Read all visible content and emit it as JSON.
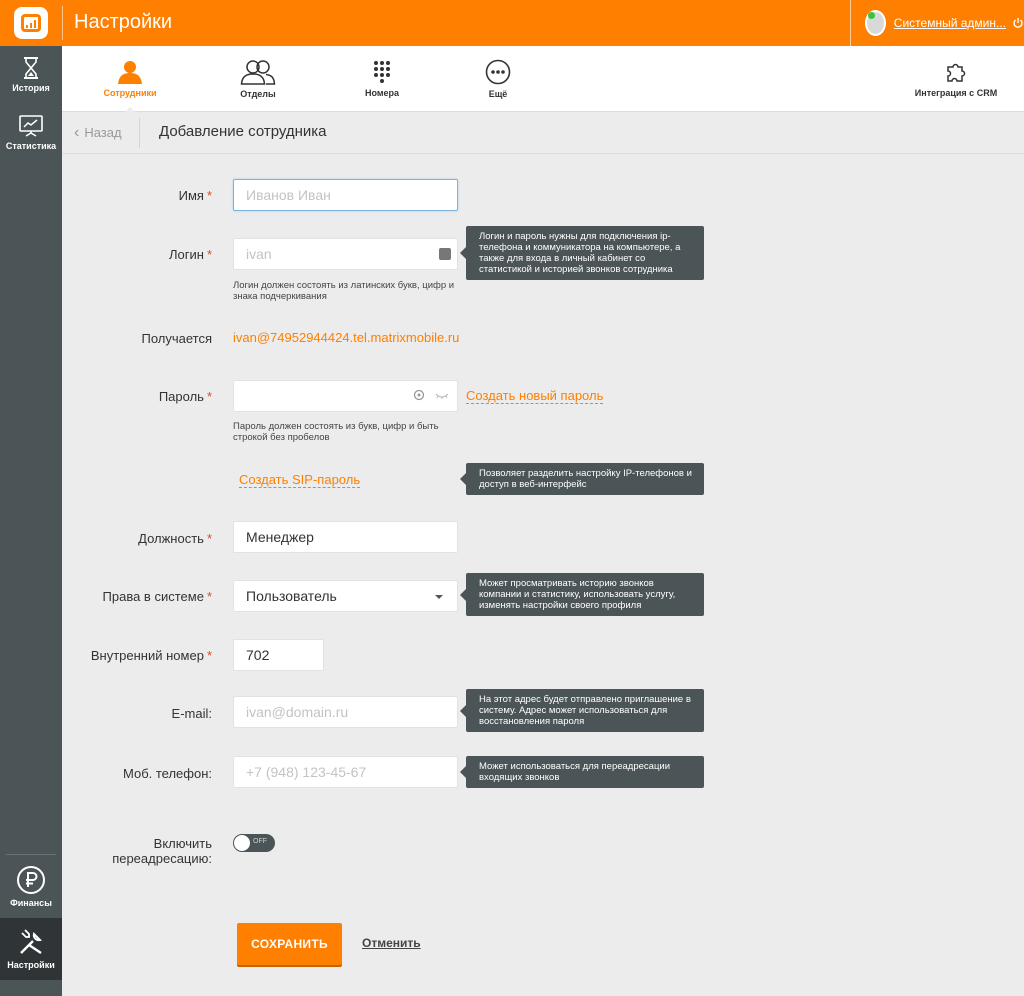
{
  "header": {
    "title": "Настройки",
    "user_name": "Системный админ...",
    "colors": {
      "brand": "#ff7f00",
      "sidebar": "#4b5457"
    }
  },
  "sidebar": {
    "items": [
      {
        "label": "История",
        "icon": "hourglass-icon"
      },
      {
        "label": "Статистика",
        "icon": "chart-board-icon"
      },
      {
        "label": "Финансы",
        "icon": "ruble-icon"
      },
      {
        "label": "Настройки",
        "icon": "tools-icon"
      }
    ]
  },
  "tabs": [
    {
      "label": "Сотрудники",
      "icon": "person-icon"
    },
    {
      "label": "Отделы",
      "icon": "people-icon"
    },
    {
      "label": "Номера",
      "icon": "keypad-icon"
    },
    {
      "label": "Ещё",
      "icon": "more-icon"
    },
    {
      "label": "Интеграция с CRM",
      "icon": "puzzle-icon"
    }
  ],
  "page": {
    "back_label": "Назад",
    "title": "Добавление сотрудника"
  },
  "form": {
    "name": {
      "label": "Имя",
      "placeholder": "Иванов Иван"
    },
    "login": {
      "label": "Логин",
      "placeholder": "ivan",
      "hint": "Логин должен состоять из латинских букв, цифр и знака подчеркивания",
      "tooltip": "Логин и пароль нужны для подключения ip-телефона и коммуникатора на компьютере, а также для входа в личный кабинет со статистикой и историей звонков сотрудника"
    },
    "result": {
      "label": "Получается",
      "value": "ivan@74952944424.tel.matrixmobile.ru"
    },
    "password": {
      "label": "Пароль",
      "create_link": "Создать новый пароль",
      "hint": "Пароль должен состоять из букв, цифр и быть строкой без пробелов"
    },
    "sip": {
      "link": "Создать SIP-пароль",
      "tooltip": "Позволяет разделить настройку IP-телефонов и доступ в веб-интерфейс"
    },
    "position": {
      "label": "Должность",
      "value": "Менеджер"
    },
    "rights": {
      "label": "Права в системе",
      "value": "Пользователь",
      "tooltip": "Может просматривать историю звонков компании и статистику, использовать услугу, изменять настройки своего профиля"
    },
    "ext": {
      "label": "Внутренний номер",
      "value": "702"
    },
    "email": {
      "label": "E-mail:",
      "placeholder": "ivan@domain.ru",
      "tooltip": "На этот адрес будет отправлено приглашение в систему. Адрес может использоваться для восстановления пароля"
    },
    "mobile": {
      "label": "Моб. телефон:",
      "placeholder": "+7 (948) 123-45-67",
      "tooltip": "Может использоваться для переадресации входящих звонков"
    },
    "redirect": {
      "label_line1": "Включить",
      "label_line2": "переадресацию:",
      "state": "OFF"
    },
    "required_mark": "*"
  },
  "actions": {
    "save": "СОХРАНИТЬ",
    "cancel": "Отменить"
  }
}
